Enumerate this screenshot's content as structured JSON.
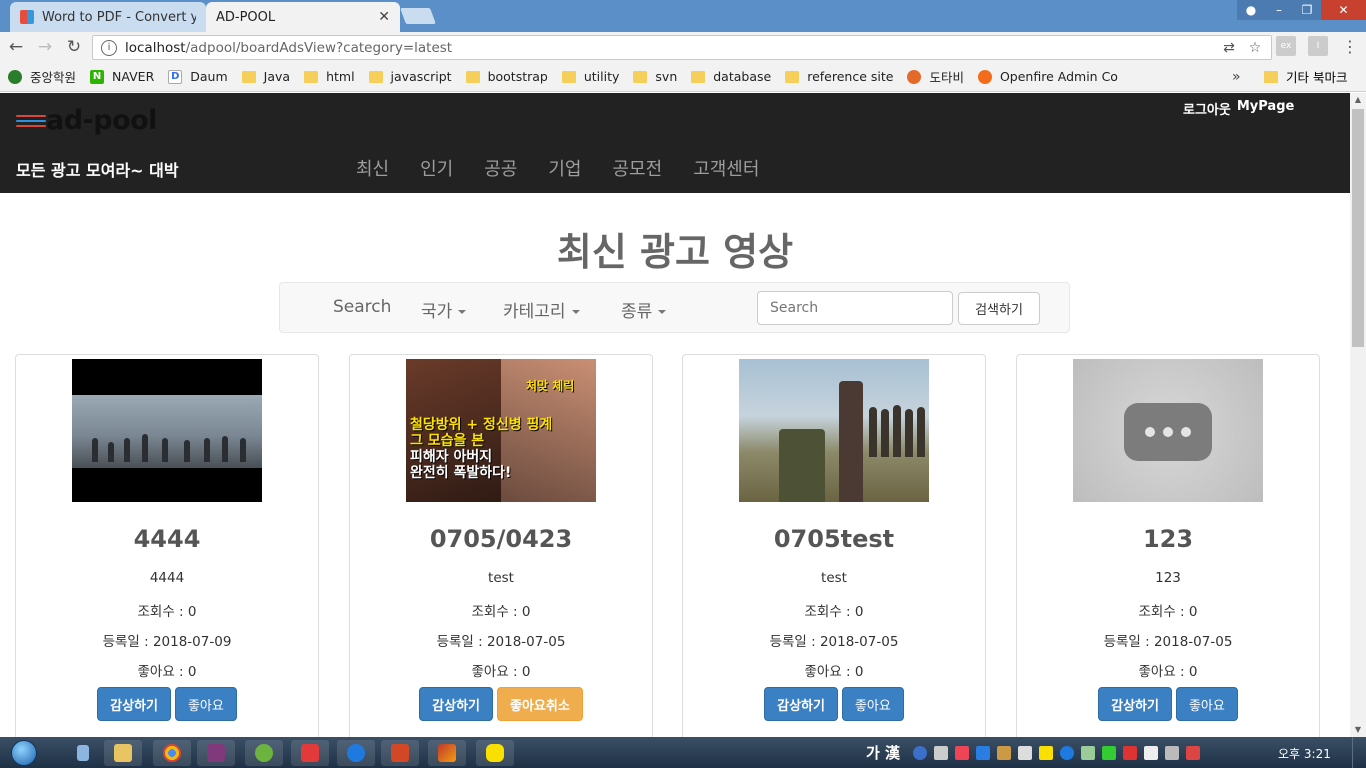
{
  "browser": {
    "tabs": [
      {
        "title": "Word to PDF - Convert y",
        "active": false
      },
      {
        "title": "AD-POOL",
        "active": true
      }
    ],
    "url_host": "localhost",
    "url_path": "/adpool/boardAdsView?category=latest",
    "bookmarks": [
      {
        "label": "중앙학원",
        "icon": "joongang-icon"
      },
      {
        "label": "NAVER",
        "icon": "naver-icon"
      },
      {
        "label": "Daum",
        "icon": "daum-icon"
      },
      {
        "label": "Java",
        "icon": "folder-icon"
      },
      {
        "label": "html",
        "icon": "folder-icon"
      },
      {
        "label": "javascript",
        "icon": "folder-icon"
      },
      {
        "label": "bootstrap",
        "icon": "folder-icon"
      },
      {
        "label": "utility",
        "icon": "folder-icon"
      },
      {
        "label": "svn",
        "icon": "folder-icon"
      },
      {
        "label": "database",
        "icon": "folder-icon"
      },
      {
        "label": "reference site",
        "icon": "folder-icon"
      },
      {
        "label": "도타비",
        "icon": "dotabi-icon"
      },
      {
        "label": "Openfire Admin Co",
        "icon": "openfire-icon"
      }
    ],
    "more_bookmarks": "»",
    "other_bookmarks": "기타 북마크"
  },
  "site": {
    "logo": "ad-pool",
    "tagline": "모든 광고 모여라~ 대박",
    "logout": "로그아웃",
    "mypage": "MyPage",
    "nav": [
      "최신",
      "인기",
      "공공",
      "기업",
      "공모전",
      "고객센터"
    ]
  },
  "page_title": "최신 광고 영상",
  "search": {
    "label": "Search",
    "dropdowns": [
      "국가",
      "카테고리",
      "종류"
    ],
    "placeholder": "Search",
    "button": "검색하기"
  },
  "cards": [
    {
      "title": "4444",
      "desc": "4444",
      "views": "조회수 : 0",
      "date": "등록일 : 2018-07-09",
      "likes": "좋아요 : 0",
      "watch": "감상하기",
      "like_btn": "좋아요",
      "liked": false
    },
    {
      "title": "0705/0423",
      "desc": "test",
      "views": "조회수 : 0",
      "date": "등록일 : 2018-07-05",
      "likes": "좋아요 : 0",
      "watch": "감상하기",
      "like_btn": "좋아요취소",
      "liked": true,
      "thumb_caption_1": "철당방위 + 정신병 핑계",
      "thumb_caption_2": "그 모습을 본",
      "thumb_caption_3": "피해자 아버지",
      "thumb_caption_4": "완전히 폭발하다!",
      "thumb_tag": "처맞 체릭"
    },
    {
      "title": "0705test",
      "desc": "test",
      "views": "조회수 : 0",
      "date": "등록일 : 2018-07-05",
      "likes": "좋아요 : 0",
      "watch": "감상하기",
      "like_btn": "좋아요",
      "liked": false
    },
    {
      "title": "123",
      "desc": "123",
      "views": "조회수 : 0",
      "date": "등록일 : 2018-07-05",
      "likes": "좋아요 : 0",
      "watch": "감상하기",
      "like_btn": "좋아요",
      "liked": false
    }
  ],
  "taskbar": {
    "ime": "가 漢",
    "clock": "오후 3:21"
  },
  "colors": {
    "header_bg": "#222222",
    "primary": "#3c80c4",
    "warning": "#f0ad4e"
  }
}
